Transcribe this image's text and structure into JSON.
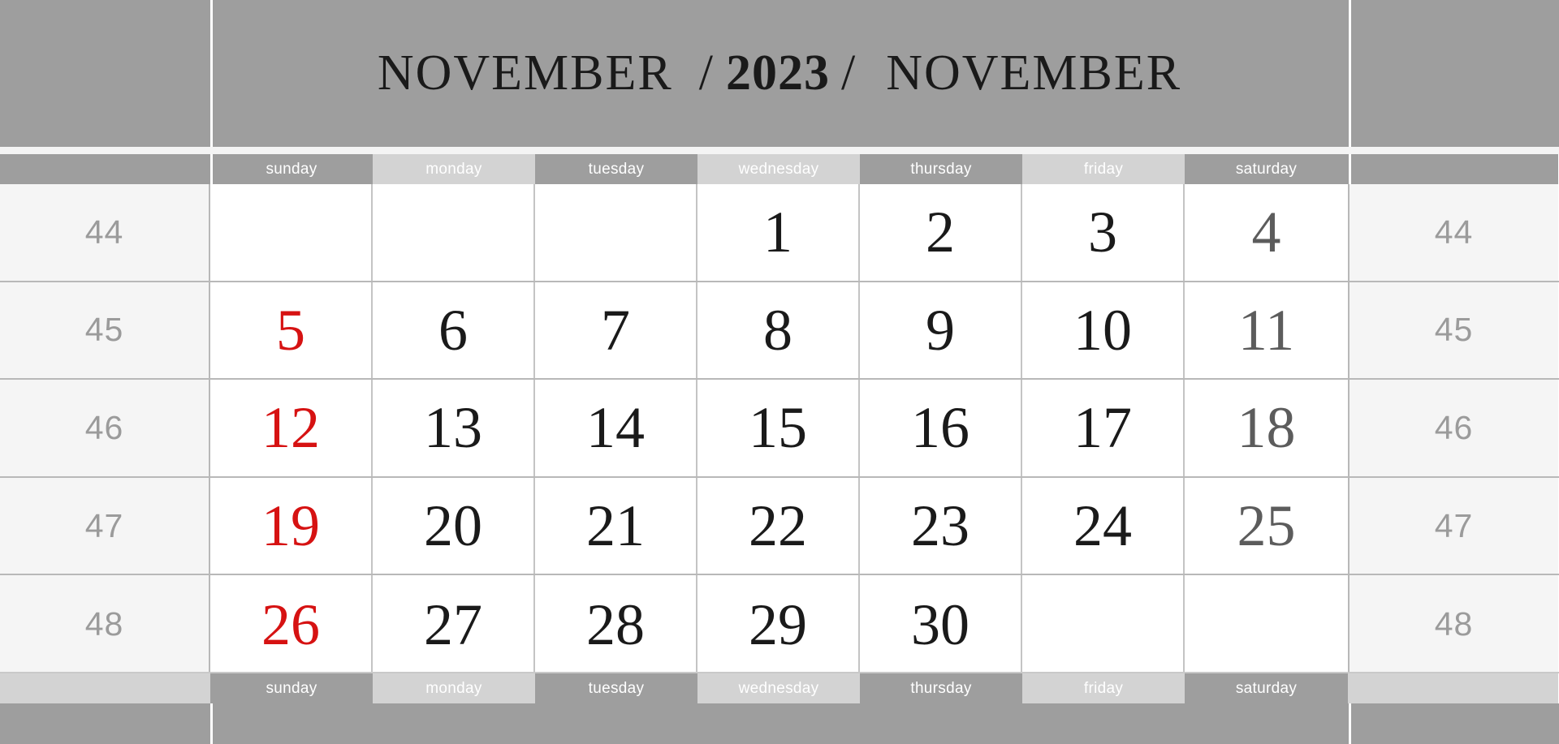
{
  "header": {
    "month_left": "NOVEMBER",
    "separator": "/",
    "year": "2023",
    "month_right": "NOVEMBER"
  },
  "weekdays": [
    {
      "label": "sunday",
      "tone": "dark"
    },
    {
      "label": "monday",
      "tone": "light"
    },
    {
      "label": "tuesday",
      "tone": "dark"
    },
    {
      "label": "wednesday",
      "tone": "light"
    },
    {
      "label": "thursday",
      "tone": "dark"
    },
    {
      "label": "friday",
      "tone": "light"
    },
    {
      "label": "saturday",
      "tone": "dark"
    }
  ],
  "weekdays_footer": [
    {
      "label": "sunday",
      "tone": "dark"
    },
    {
      "label": "monday",
      "tone": "light"
    },
    {
      "label": "tuesday",
      "tone": "dark"
    },
    {
      "label": "wednesday",
      "tone": "light"
    },
    {
      "label": "thursday",
      "tone": "dark"
    },
    {
      "label": "friday",
      "tone": "light"
    },
    {
      "label": "saturday",
      "tone": "dark"
    }
  ],
  "week_numbers": [
    "44",
    "45",
    "46",
    "47",
    "48"
  ],
  "weeks": [
    {
      "number": "44",
      "days": [
        "",
        "",
        "",
        "1",
        "2",
        "3",
        "4"
      ]
    },
    {
      "number": "45",
      "days": [
        "5",
        "6",
        "7",
        "8",
        "9",
        "10",
        "11"
      ]
    },
    {
      "number": "46",
      "days": [
        "12",
        "13",
        "14",
        "15",
        "16",
        "17",
        "18"
      ]
    },
    {
      "number": "47",
      "days": [
        "19",
        "20",
        "21",
        "22",
        "23",
        "24",
        "25"
      ]
    },
    {
      "number": "48",
      "days": [
        "26",
        "27",
        "28",
        "29",
        "30",
        "",
        ""
      ]
    }
  ],
  "colors": {
    "band_gray": "#9e9e9e",
    "weekday_dark": "#9e9e9e",
    "weekday_light": "#d3d3d3",
    "week_number_bg": "#f5f5f5",
    "week_number_text": "#9b9b9b",
    "sunday_red": "#d61212",
    "saturday_gray": "#5c5c5c",
    "weekday_text": "#1a1a1a",
    "grid_line": "#c4c4c4",
    "cell_bg": "#ffffff"
  }
}
